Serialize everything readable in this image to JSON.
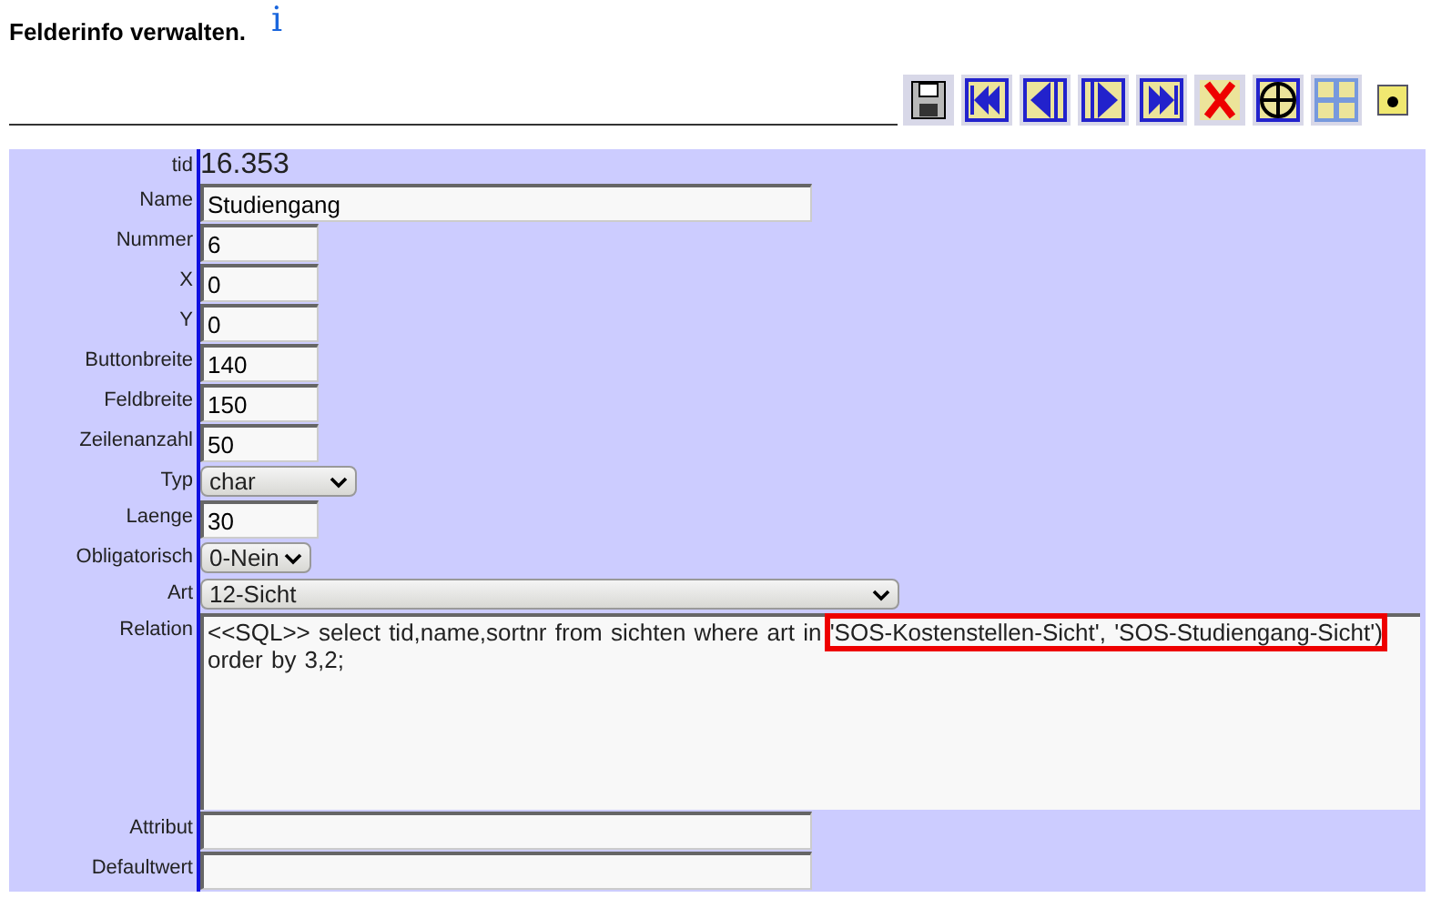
{
  "title": "Felderinfo verwalten.",
  "info_link": "i",
  "toolbar": [
    {
      "kind": "save"
    },
    {
      "kind": "first"
    },
    {
      "kind": "prev"
    },
    {
      "kind": "next"
    },
    {
      "kind": "last"
    },
    {
      "kind": "delete"
    },
    {
      "kind": "add"
    },
    {
      "kind": "grid"
    },
    {
      "kind": "dot"
    }
  ],
  "fields": [
    {
      "label": "tid",
      "kind": "static",
      "value": "16.353"
    },
    {
      "label": "Name",
      "kind": "wide-input",
      "value": "Studiengang"
    },
    {
      "label": "Nummer",
      "kind": "narrow-input",
      "value": "6"
    },
    {
      "label": "X",
      "kind": "narrow-input",
      "value": "0"
    },
    {
      "label": "Y",
      "kind": "narrow-input",
      "value": "0"
    },
    {
      "label": "Buttonbreite",
      "kind": "narrow-input",
      "value": "140"
    },
    {
      "label": "Feldbreite",
      "kind": "narrow-input",
      "value": "150"
    },
    {
      "label": "Zeilenanzahl",
      "kind": "narrow-input",
      "value": "50"
    },
    {
      "label": "Typ",
      "kind": "select",
      "value": "char"
    },
    {
      "label": "Laenge",
      "kind": "narrow-input",
      "value": "30"
    },
    {
      "label": "Obligatorisch",
      "kind": "small-select",
      "value": "0-Nein"
    },
    {
      "label": "Art",
      "kind": "wide-select",
      "value": "12-Sicht"
    },
    {
      "label": "Relation",
      "kind": "textarea",
      "segments": [
        {
          "text": "<<SQL>> select tid,name,sortnr from sichten where art in ",
          "highlighted": false
        },
        {
          "text": "'SOS-Kostenstellen-Sicht', 'SOS-Studiengang-Sicht')",
          "highlighted": true
        },
        {
          "text": " order by 3,2;",
          "highlighted": false
        }
      ]
    },
    {
      "label": "Attribut",
      "kind": "wide-input"
    },
    {
      "label": "Defaultwert",
      "kind": "wide-input"
    }
  ]
}
